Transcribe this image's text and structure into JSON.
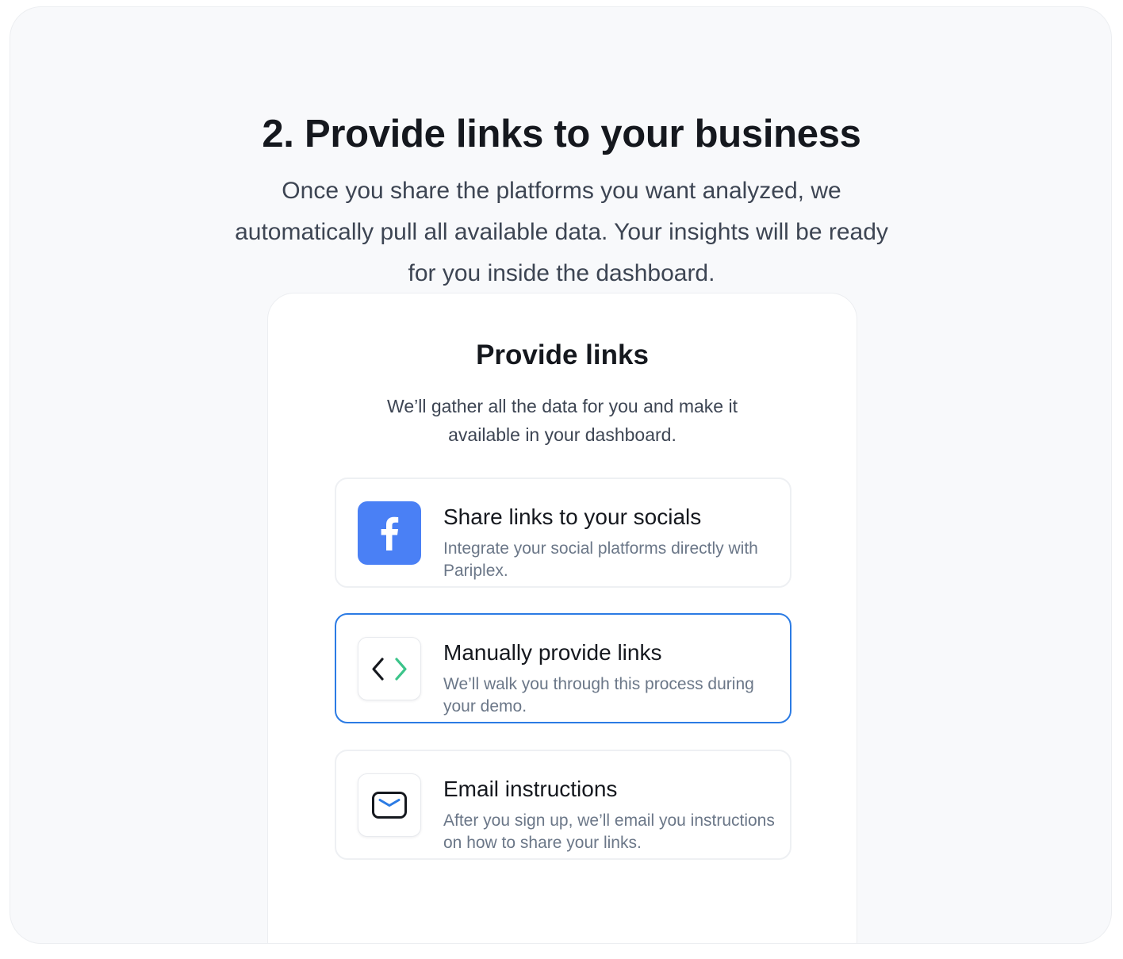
{
  "section": {
    "heading": "2. Provide links to your business",
    "lead": "Once you share the platforms you want analyzed, we automatically pull all available data. Your insights will be ready for you inside the dashboard."
  },
  "card": {
    "title": "Provide links",
    "subtitle": "We’ll gather all the data for you and make it available in your dashboard.",
    "options": [
      {
        "icon": "facebook-icon",
        "title": "Share links to your socials",
        "description": "Integrate your social platforms directly with Pariplex.",
        "selected": false
      },
      {
        "icon": "code-brackets-icon",
        "title": "Manually provide links",
        "description": "We’ll walk you through this process during your demo.",
        "selected": true
      },
      {
        "icon": "mail-icon",
        "title": "Email instructions",
        "description": "After you sign up, we’ll email you instructions on how to share your links.",
        "selected": false
      }
    ]
  },
  "colors": {
    "accent": "#2b7be4",
    "facebook": "#4a80f5",
    "code_green": "#3cc48a",
    "mail_blue": "#2b7be4"
  }
}
